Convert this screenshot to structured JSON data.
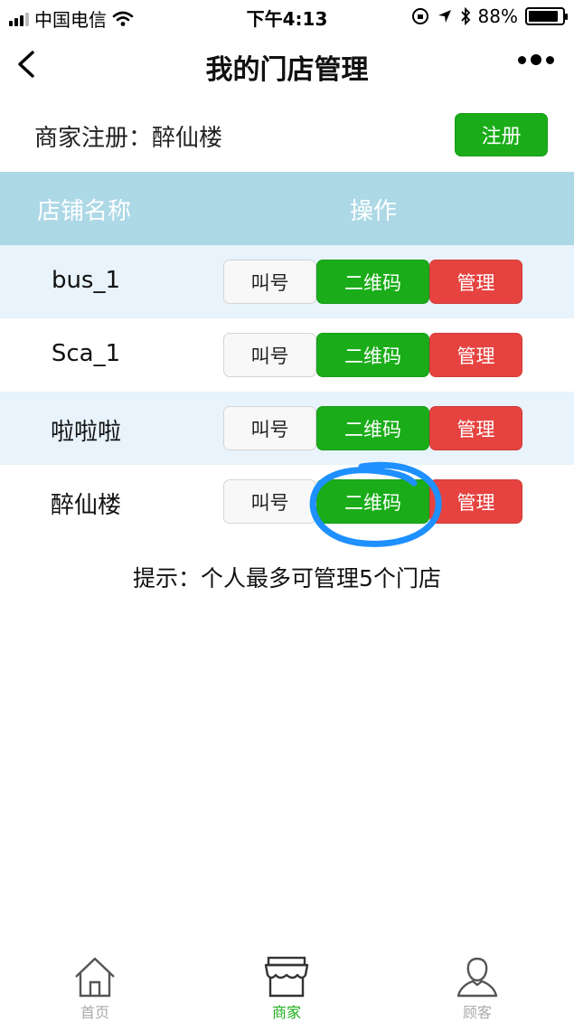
{
  "status_bar": {
    "carrier": "中国电信",
    "time": "下午4:13",
    "battery": "88%",
    "battery_level": 0.88
  },
  "nav": {
    "title": "我的门店管理"
  },
  "merchant": {
    "label": "商家注册：醉仙楼",
    "register_label": "注册"
  },
  "table": {
    "headers": {
      "name": "店铺名称",
      "operation": "操作"
    },
    "rows": [
      {
        "name": "bus_1",
        "call": "叫号",
        "qrcode": "二维码",
        "manage": "管理"
      },
      {
        "name": "Sca_1",
        "call": "叫号",
        "qrcode": "二维码",
        "manage": "管理"
      },
      {
        "name": "啦啦啦",
        "call": "叫号",
        "qrcode": "二维码",
        "manage": "管理"
      },
      {
        "name": "醉仙楼",
        "call": "叫号",
        "qrcode": "二维码",
        "manage": "管理"
      }
    ]
  },
  "hint": "提示：个人最多可管理5个门店",
  "tab_bar": {
    "items": [
      {
        "label": "首页",
        "icon": "home-icon",
        "active": false
      },
      {
        "label": "商家",
        "icon": "store-icon",
        "active": true
      },
      {
        "label": "顾客",
        "icon": "user-icon",
        "active": false
      }
    ]
  },
  "colors": {
    "primary_green": "#1aad19",
    "danger_red": "#e64340",
    "header_blue": "#add8e6",
    "row_alt": "#e8f3fb",
    "annotation_blue": "#1e90ff"
  }
}
